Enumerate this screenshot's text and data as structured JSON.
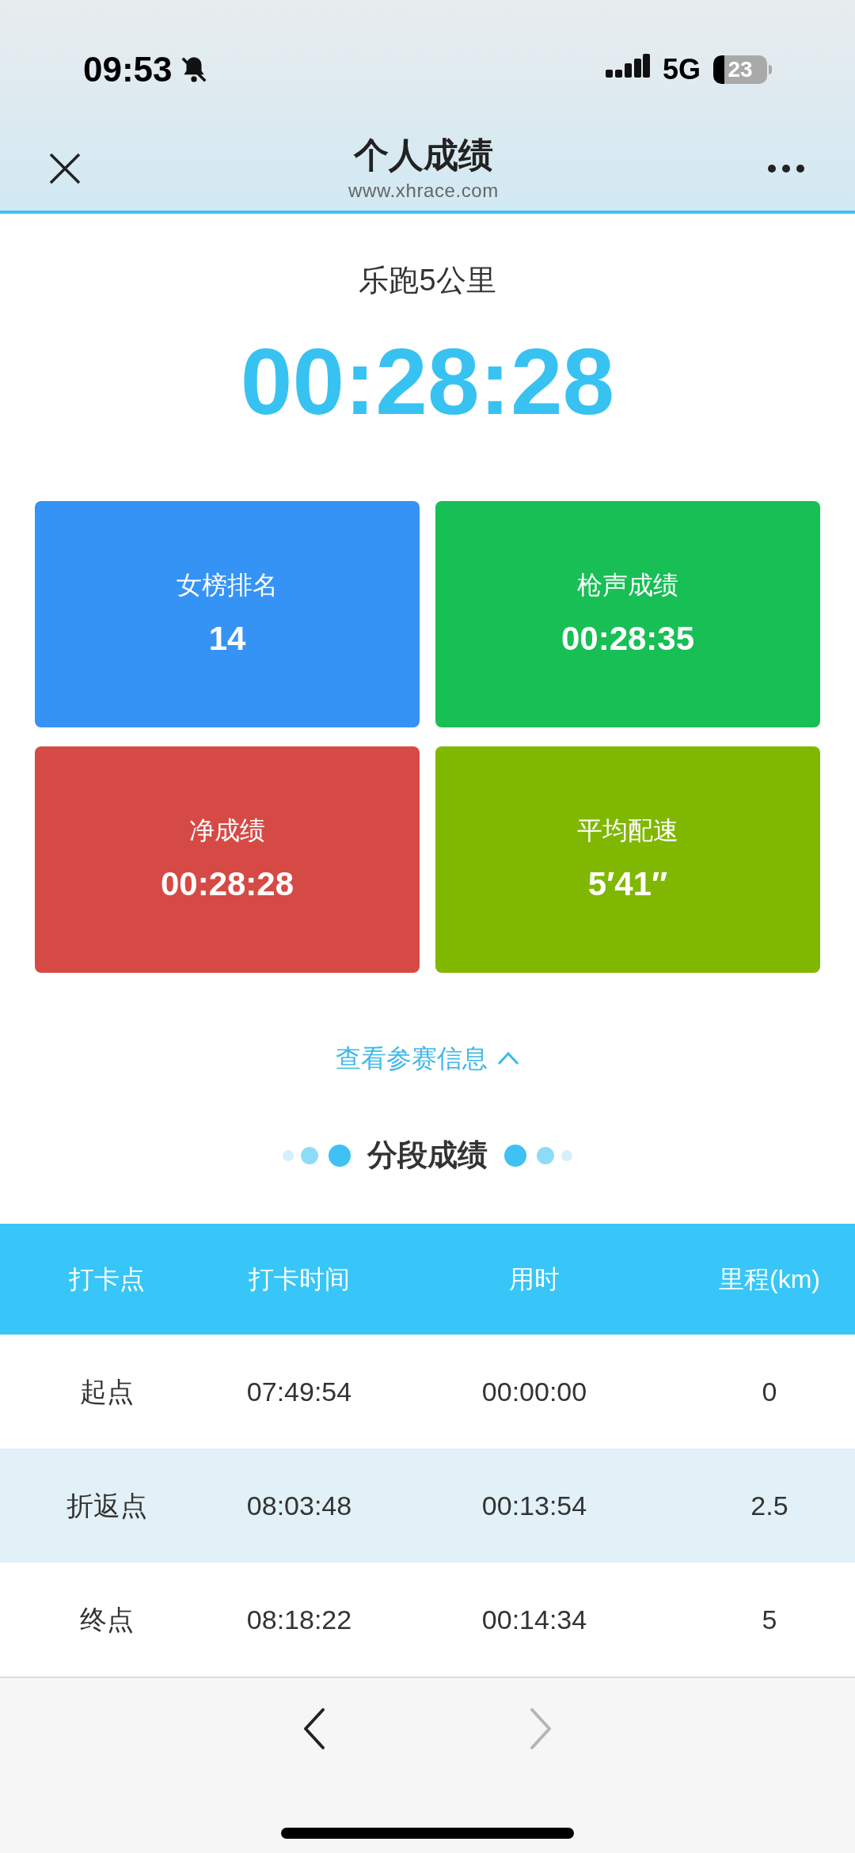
{
  "status_bar": {
    "time": "09:53",
    "network": "5G",
    "battery": "23"
  },
  "header": {
    "title": "个人成绩",
    "url": "www.xhrace.com"
  },
  "event": "乐跑5公里",
  "finish_time": "00:28:28",
  "stats": [
    {
      "label": "女榜排名",
      "value": "14",
      "color": "#3593f5"
    },
    {
      "label": "枪声成绩",
      "value": "00:28:35",
      "color": "#17bf55"
    },
    {
      "label": "净成绩",
      "value": "00:28:28",
      "color": "#d64a45"
    },
    {
      "label": "平均配速",
      "value": "5′41″",
      "color": "#80b700"
    }
  ],
  "info_link": {
    "label": "查看参赛信息",
    "expanded": true
  },
  "section_title": "分段成绩",
  "table": {
    "columns": [
      "打卡点",
      "打卡时间",
      "用时",
      "里程(km)"
    ],
    "rows": [
      [
        "起点",
        "07:49:54",
        "00:00:00",
        "0"
      ],
      [
        "折返点",
        "08:03:48",
        "00:13:54",
        "2.5"
      ],
      [
        "终点",
        "08:18:22",
        "00:14:34",
        "5"
      ]
    ]
  },
  "nav": {
    "back_disabled": false,
    "forward_disabled": true
  }
}
